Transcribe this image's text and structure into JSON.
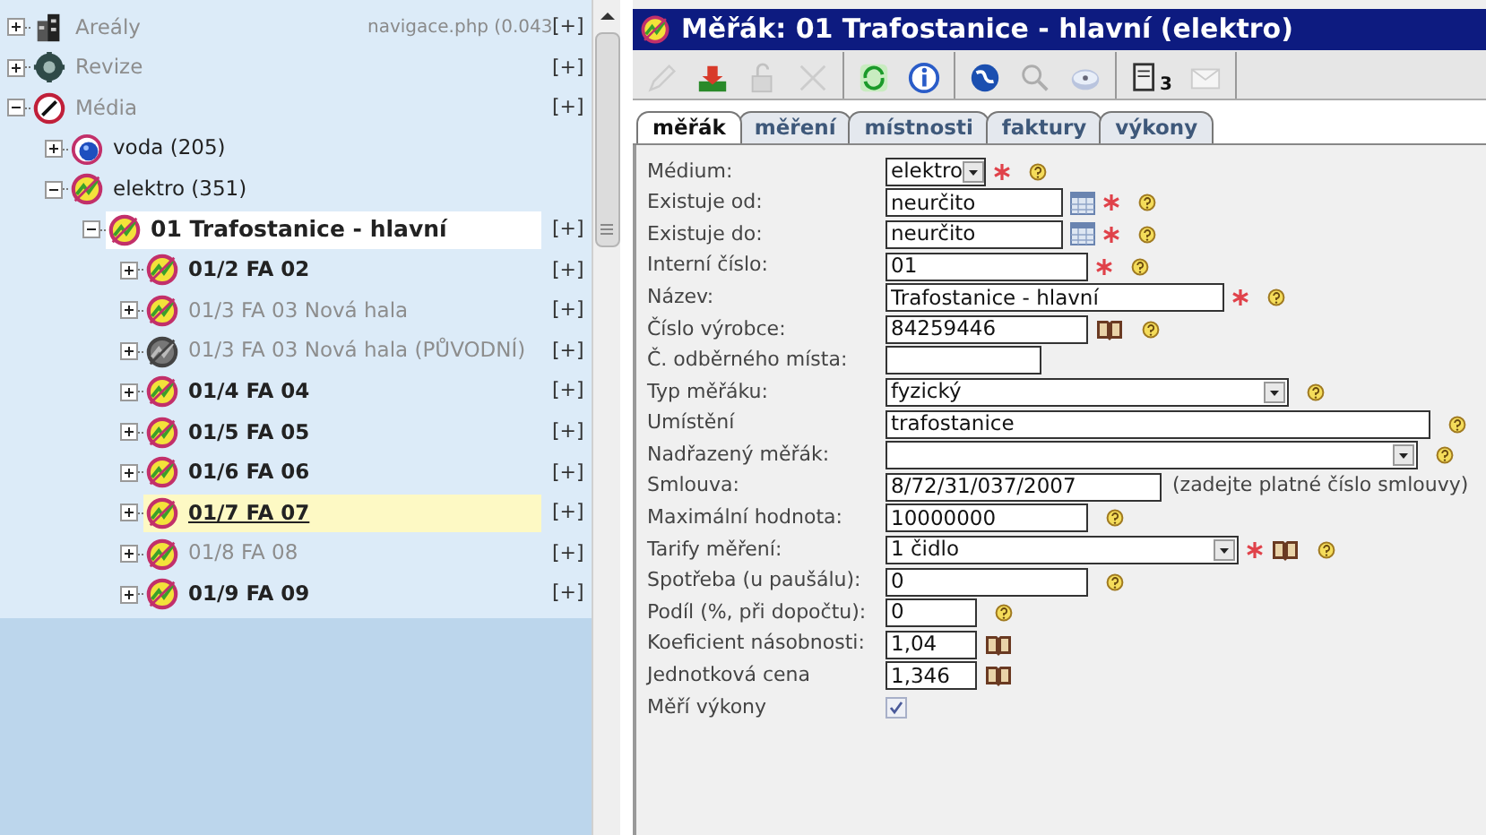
{
  "navigation": {
    "status_text": "navigace.php (0.043",
    "tree": [
      {
        "label": "Areály",
        "kind": "building",
        "expanded": false,
        "dimmed": true,
        "selected": false,
        "hovered": false,
        "link": "[+]"
      },
      {
        "label": "Revize",
        "kind": "gear",
        "expanded": false,
        "dimmed": true,
        "selected": false,
        "hovered": false,
        "link": "[+]"
      },
      {
        "label": "Média",
        "kind": "gauge",
        "expanded": true,
        "dimmed": true,
        "selected": false,
        "hovered": false,
        "link": "[+]",
        "children": [
          {
            "label": "voda (205)",
            "kind": "water",
            "expanded": false,
            "dimmed": false,
            "selected": false,
            "hovered": false
          },
          {
            "label": "elektro (351)",
            "kind": "electric",
            "expanded": true,
            "dimmed": false,
            "selected": false,
            "hovered": false,
            "children": [
              {
                "label": "01 Trafostanice - hlavní",
                "kind": "electric",
                "expanded": true,
                "dimmed": false,
                "selected": true,
                "hovered": false,
                "link": "[+]",
                "children": [
                  {
                    "label": "01/2 FA 02",
                    "kind": "electric",
                    "expanded": false,
                    "dimmed": false,
                    "selected": false,
                    "hovered": false,
                    "link": "[+]"
                  },
                  {
                    "label": "01/3 FA 03 Nová hala",
                    "kind": "electric",
                    "expanded": false,
                    "dimmed": true,
                    "selected": false,
                    "hovered": false,
                    "link": "[+]"
                  },
                  {
                    "label": "01/3 FA 03 Nová hala (PŮVODNÍ)",
                    "kind": "electric-grey",
                    "expanded": false,
                    "dimmed": true,
                    "selected": false,
                    "hovered": false,
                    "link": "[+]"
                  },
                  {
                    "label": "01/4 FA 04",
                    "kind": "electric",
                    "expanded": false,
                    "dimmed": false,
                    "selected": false,
                    "hovered": false,
                    "link": "[+]"
                  },
                  {
                    "label": "01/5 FA 05",
                    "kind": "electric",
                    "expanded": false,
                    "dimmed": false,
                    "selected": false,
                    "hovered": false,
                    "link": "[+]"
                  },
                  {
                    "label": "01/6 FA 06",
                    "kind": "electric",
                    "expanded": false,
                    "dimmed": false,
                    "selected": false,
                    "hovered": false,
                    "link": "[+]"
                  },
                  {
                    "label": "01/7 FA 07",
                    "kind": "electric",
                    "expanded": false,
                    "dimmed": false,
                    "selected": false,
                    "hovered": true,
                    "link": "[+]"
                  },
                  {
                    "label": "01/8 FA 08",
                    "kind": "electric",
                    "expanded": false,
                    "dimmed": true,
                    "selected": false,
                    "hovered": false,
                    "link": "[+]"
                  },
                  {
                    "label": "01/9 FA 09",
                    "kind": "electric",
                    "expanded": false,
                    "dimmed": false,
                    "selected": false,
                    "hovered": false,
                    "link": "[+]"
                  }
                ]
              }
            ]
          }
        ]
      }
    ]
  },
  "window": {
    "title": "Měřák: 01 Trafostanice - hlavní (elektro)"
  },
  "toolbar": [
    [
      {
        "kind": "pencil",
        "disabled": true
      },
      {
        "kind": "inbox",
        "disabled": false
      },
      {
        "kind": "lock",
        "disabled": true
      },
      {
        "kind": "delete",
        "disabled": true
      }
    ],
    [
      {
        "kind": "refresh",
        "disabled": false
      },
      {
        "kind": "info",
        "disabled": false
      }
    ],
    [
      {
        "kind": "globe",
        "disabled": false
      },
      {
        "kind": "search",
        "disabled": true
      },
      {
        "kind": "disk",
        "disabled": false
      }
    ],
    [
      {
        "kind": "document",
        "disabled": false,
        "badge": "3"
      },
      {
        "kind": "mail",
        "disabled": true
      }
    ]
  ],
  "tabs": [
    {
      "label": "měřák",
      "selected": true
    },
    {
      "label": "měření",
      "selected": false
    },
    {
      "label": "místnosti",
      "selected": false
    },
    {
      "label": "faktury",
      "selected": false
    },
    {
      "label": "výkony",
      "selected": false
    }
  ],
  "form": [
    {
      "label": "Médium:",
      "kind": "select",
      "value": "elektro",
      "required": true,
      "help": true
    },
    {
      "label": "Existuje od:",
      "kind": "input",
      "value": "neurčito",
      "calendar": true,
      "required": true,
      "help": true
    },
    {
      "label": "Existuje do:",
      "kind": "input",
      "value": "neurčito",
      "calendar": true,
      "required": true,
      "help": true
    },
    {
      "label": "Interní číslo:",
      "kind": "input",
      "value": "01",
      "required": true,
      "help": true
    },
    {
      "label": "Název:",
      "kind": "input",
      "value": "Trafostanice - hlavní",
      "required": true,
      "help": true
    },
    {
      "label": "Číslo výrobce:",
      "kind": "input",
      "value": "84259446",
      "book": true,
      "help": true
    },
    {
      "label": "Č. odběrného místa:",
      "kind": "input"
    },
    {
      "label": "Typ měřáku:",
      "kind": "select",
      "value": "fyzický",
      "help": true
    },
    {
      "label": "Umístění",
      "kind": "input",
      "value": "trafostanice",
      "help": true
    },
    {
      "label": "Nadřazený měřák:",
      "kind": "select",
      "help": true
    },
    {
      "label": "Smlouva:",
      "kind": "input",
      "value": "8/72/31/037/2007",
      "hint": "(zadejte platné číslo smlouvy)"
    },
    {
      "label": "Maximální hodnota:",
      "kind": "input",
      "value": "10000000",
      "help": true
    },
    {
      "label": "Tarify měření:",
      "kind": "select",
      "value": "1 čidlo",
      "required": true,
      "book": true,
      "help": true
    },
    {
      "label": "Spotřeba (u paušálu):",
      "kind": "input",
      "value": "0",
      "help": true
    },
    {
      "label": "Podíl (%, při dopočtu):",
      "kind": "input",
      "value": "0",
      "help": true
    },
    {
      "label": "Koeficient násobnosti:",
      "kind": "input",
      "value": "1,04",
      "book": true
    },
    {
      "label": "Jednotková cena",
      "kind": "input",
      "value": "1,346",
      "book": true
    },
    {
      "label": "Měří výkony",
      "kind": "checkbox",
      "checked": true
    }
  ]
}
